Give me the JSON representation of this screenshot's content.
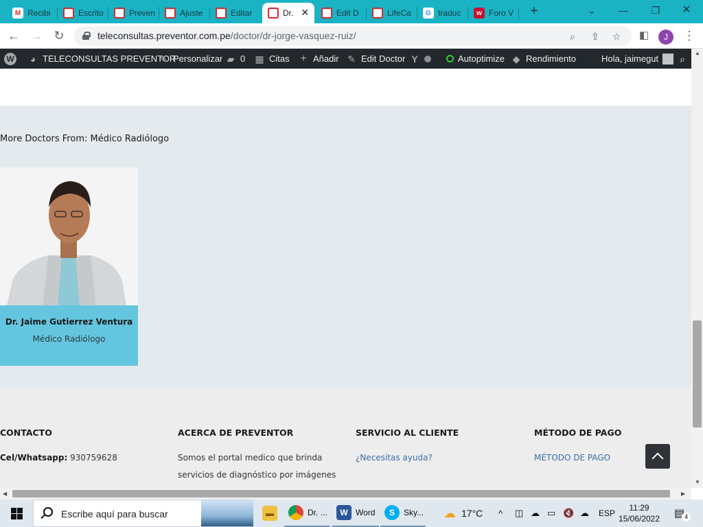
{
  "browser": {
    "tabs": [
      {
        "label": "Recibi",
        "favicon": "gmail-icon"
      },
      {
        "label": "Escrito",
        "favicon": "preventor-icon"
      },
      {
        "label": "Preven",
        "favicon": "preventor-icon"
      },
      {
        "label": "Ajuste",
        "favicon": "preventor-icon"
      },
      {
        "label": "Editar",
        "favicon": "preventor-icon"
      },
      {
        "label": "Dr.",
        "favicon": "preventor-icon",
        "active": true
      },
      {
        "label": "Edit D",
        "favicon": "preventor-icon"
      },
      {
        "label": "LifeCa",
        "favicon": "preventor-icon"
      },
      {
        "label": "traduc",
        "favicon": "google-icon"
      },
      {
        "label": "Foro V",
        "favicon": "foro-icon"
      }
    ],
    "new_tab": "+",
    "url_host": "teleconsultas.preventor.com.pe",
    "url_path": "/doctor/dr-jorge-vasquez-ruiz/",
    "profile_initial": "J",
    "accent": "#1ab3c4"
  },
  "adminbar": {
    "site_name": "TELECONSULTAS PREVENTOR",
    "customize": "Personalizar",
    "comments_count": "0",
    "appointments": "Citas",
    "add_new": "Añadir",
    "edit_doctor": "Edit Doctor",
    "autoptimize": "Autoptimize",
    "performance": "Rendimiento",
    "greeting": "Hola, jaimegut"
  },
  "more_doctors": {
    "title": "More Doctors From: Médico Radiólogo",
    "doctor_name": "Dr. Jaime Gutierrez Ventura",
    "doctor_specialty": "Médico Radiólogo",
    "card_color": "#64c6de"
  },
  "footer": {
    "contact_heading": "CONTACTO",
    "contact_phone_label": "Cel/Whatsapp:",
    "contact_phone": "930759628",
    "about_heading": "ACERCA DE PREVENTOR",
    "about_line1": "Somos el portal medico que brinda",
    "about_line2": "servicios de diagnóstico por imágenes",
    "service_heading": "SERVICIO AL CLIENTE",
    "service_link": "¿Necesitas ayuda?",
    "payment_heading": "MÉTODO DE PAGO",
    "payment_link": "MÉTODO DE PAGO"
  },
  "taskbar": {
    "search_placeholder": "Escribe aquí para buscar",
    "apps": [
      {
        "label": "",
        "icon": "file-explorer-icon"
      },
      {
        "label": "Dr. ...",
        "icon": "chrome-icon"
      },
      {
        "label": "Word",
        "icon": "word-icon"
      },
      {
        "label": "Sky...",
        "icon": "skype-icon"
      }
    ],
    "temperature": "17°C",
    "language": "ESP",
    "time": "11:29",
    "date": "15/06/2022",
    "notifications": "4"
  }
}
